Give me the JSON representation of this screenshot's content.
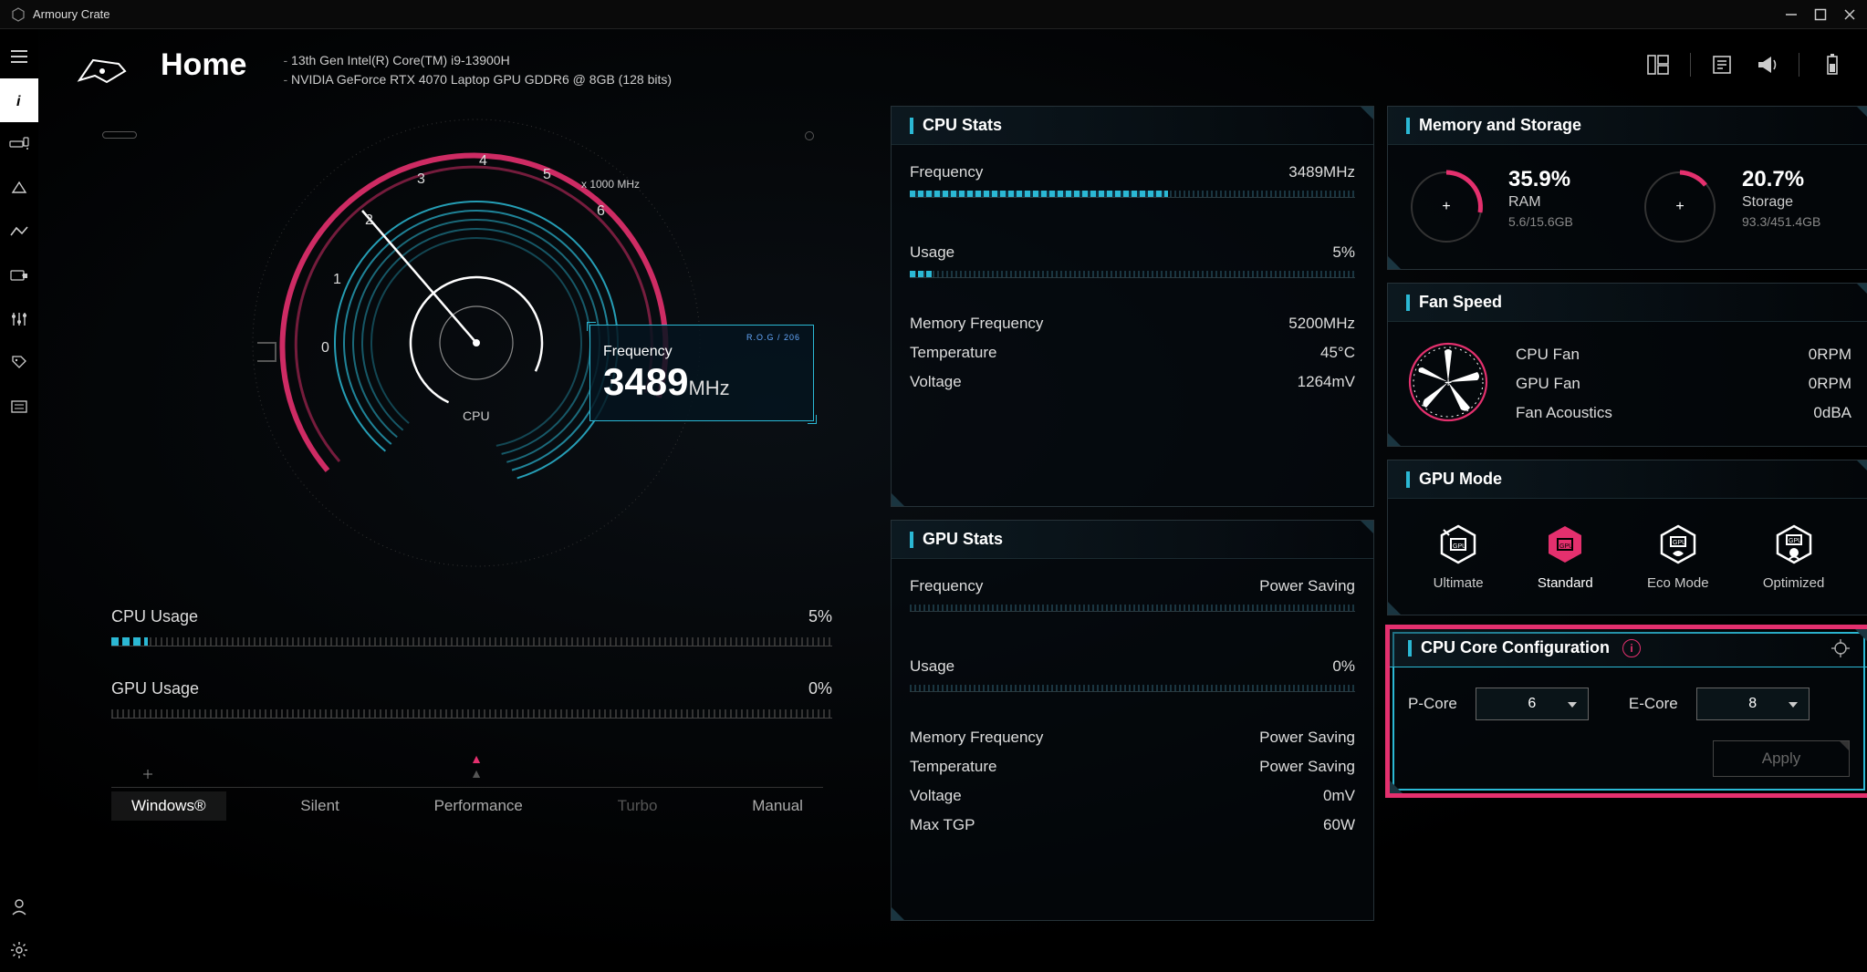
{
  "window": {
    "title": "Armoury Crate"
  },
  "header": {
    "page_title": "Home",
    "spec1": "13th Gen Intel(R) Core(TM) i9-13900H",
    "spec2": "NVIDIA GeForce RTX 4070 Laptop GPU GDDR6 @ 8GB (128 bits)"
  },
  "gauge": {
    "scale_label": "x 1000 MHz",
    "cpu_label": "CPU",
    "marks": [
      "0",
      "1",
      "2",
      "3",
      "4",
      "5",
      "6"
    ],
    "freq_header": "R.O.G / 206",
    "freq_label": "Frequency",
    "freq_value": "3489",
    "freq_unit": "MHz"
  },
  "usage_meters": {
    "cpu_label": "CPU Usage",
    "cpu_value": "5%",
    "gpu_label": "GPU Usage",
    "gpu_value": "0%"
  },
  "profiles": {
    "windows": "Windows®",
    "silent": "Silent",
    "performance": "Performance",
    "turbo": "Turbo",
    "manual": "Manual"
  },
  "cpu_stats": {
    "title": "CPU Stats",
    "freq_label": "Frequency",
    "freq_value": "3489MHz",
    "usage_label": "Usage",
    "usage_value": "5%",
    "mem_label": "Memory Frequency",
    "mem_value": "5200MHz",
    "temp_label": "Temperature",
    "temp_value": "45°C",
    "volt_label": "Voltage",
    "volt_value": "1264mV"
  },
  "gpu_stats": {
    "title": "GPU Stats",
    "freq_label": "Frequency",
    "freq_value": "Power Saving",
    "usage_label": "Usage",
    "usage_value": "0%",
    "mem_label": "Memory Frequency",
    "mem_value": "Power Saving",
    "temp_label": "Temperature",
    "temp_value": "Power Saving",
    "volt_label": "Voltage",
    "volt_value": "0mV",
    "tgp_label": "Max TGP",
    "tgp_value": "60W"
  },
  "memory": {
    "title": "Memory and Storage",
    "ram_pct": "35.9%",
    "ram_label": "RAM",
    "ram_sub": "5.6/15.6GB",
    "storage_pct": "20.7%",
    "storage_label": "Storage",
    "storage_sub": "93.3/451.4GB"
  },
  "fan": {
    "title": "Fan Speed",
    "cpu_label": "CPU Fan",
    "cpu_value": "0RPM",
    "gpu_label": "GPU Fan",
    "gpu_value": "0RPM",
    "acoustic_label": "Fan Acoustics",
    "acoustic_value": "0dBA"
  },
  "gpu_mode": {
    "title": "GPU Mode",
    "ultimate": "Ultimate",
    "standard": "Standard",
    "eco": "Eco Mode",
    "optimized": "Optimized"
  },
  "core": {
    "title": "CPU Core Configuration",
    "pcore_label": "P-Core",
    "pcore_value": "6",
    "ecore_label": "E-Core",
    "ecore_value": "8",
    "apply": "Apply"
  }
}
